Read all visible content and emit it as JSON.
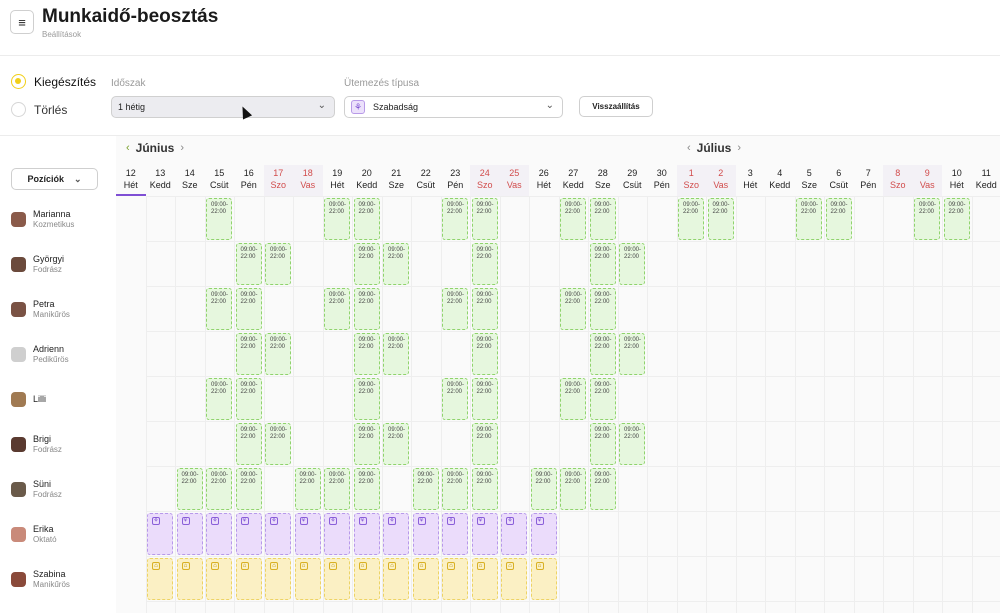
{
  "header": {
    "title": "Munkaidő-beosztás",
    "subtitle": "Beállítások",
    "menu_icon": "hamburger-icon"
  },
  "mode": {
    "options": [
      {
        "label": "Kiegészítés",
        "selected": true
      },
      {
        "label": "Törlés",
        "selected": false
      }
    ]
  },
  "period": {
    "label": "Időszak",
    "value": "1 hétig"
  },
  "schedule_type": {
    "label": "Ütemezés típusa",
    "value": "Szabadság",
    "icon": "vacation-icon"
  },
  "reset_label": "Visszaállítás",
  "positions_label": "Pozíciók",
  "months": [
    {
      "name": "Június"
    },
    {
      "name": "Július"
    }
  ],
  "days": [
    {
      "n": "12",
      "d": "Hét"
    },
    {
      "n": "13",
      "d": "Kedd"
    },
    {
      "n": "14",
      "d": "Sze"
    },
    {
      "n": "15",
      "d": "Csüt"
    },
    {
      "n": "16",
      "d": "Pén"
    },
    {
      "n": "17",
      "d": "Szo"
    },
    {
      "n": "18",
      "d": "Vas"
    },
    {
      "n": "19",
      "d": "Hét"
    },
    {
      "n": "20",
      "d": "Kedd"
    },
    {
      "n": "21",
      "d": "Sze"
    },
    {
      "n": "22",
      "d": "Csüt"
    },
    {
      "n": "23",
      "d": "Pén"
    },
    {
      "n": "24",
      "d": "Szo"
    },
    {
      "n": "25",
      "d": "Vas"
    },
    {
      "n": "26",
      "d": "Hét"
    },
    {
      "n": "27",
      "d": "Kedd"
    },
    {
      "n": "28",
      "d": "Sze"
    },
    {
      "n": "29",
      "d": "Csüt"
    },
    {
      "n": "30",
      "d": "Pén"
    },
    {
      "n": "1",
      "d": "Szo"
    },
    {
      "n": "2",
      "d": "Vas"
    },
    {
      "n": "3",
      "d": "Hét"
    },
    {
      "n": "4",
      "d": "Kedd"
    },
    {
      "n": "5",
      "d": "Sze"
    },
    {
      "n": "6",
      "d": "Csüt"
    },
    {
      "n": "7",
      "d": "Pén"
    },
    {
      "n": "8",
      "d": "Szo"
    },
    {
      "n": "9",
      "d": "Vas"
    },
    {
      "n": "10",
      "d": "Hét"
    },
    {
      "n": "11",
      "d": "Kedd"
    }
  ],
  "shift_text": "09:00-\n22:00",
  "staff": [
    {
      "name": "Marianna",
      "role": "Kozmetikus",
      "avatar": "#8a5a4a",
      "cells": [
        {
          "col": 2,
          "type": "green"
        },
        {
          "col": 6,
          "type": "green"
        },
        {
          "col": 7,
          "type": "green"
        },
        {
          "col": 10,
          "type": "green"
        },
        {
          "col": 11,
          "type": "green"
        },
        {
          "col": 14,
          "type": "green"
        },
        {
          "col": 15,
          "type": "green"
        },
        {
          "col": 18,
          "type": "green"
        },
        {
          "col": 19,
          "type": "green"
        },
        {
          "col": 22,
          "type": "green"
        },
        {
          "col": 23,
          "type": "green"
        },
        {
          "col": 26,
          "type": "green"
        },
        {
          "col": 27,
          "type": "green"
        }
      ]
    },
    {
      "name": "Györgyi",
      "role": "Fodrász",
      "avatar": "#6b4a3c",
      "cells": [
        {
          "col": 3,
          "type": "green"
        },
        {
          "col": 4,
          "type": "green"
        },
        {
          "col": 7,
          "type": "green"
        },
        {
          "col": 8,
          "type": "green"
        },
        {
          "col": 11,
          "type": "green"
        },
        {
          "col": 15,
          "type": "green"
        },
        {
          "col": 16,
          "type": "green"
        }
      ]
    },
    {
      "name": "Petra",
      "role": "Manikűrös",
      "avatar": "#7a5244",
      "cells": [
        {
          "col": 2,
          "type": "green"
        },
        {
          "col": 3,
          "type": "green"
        },
        {
          "col": 6,
          "type": "green"
        },
        {
          "col": 7,
          "type": "green"
        },
        {
          "col": 10,
          "type": "green"
        },
        {
          "col": 11,
          "type": "green"
        },
        {
          "col": 14,
          "type": "green"
        },
        {
          "col": 15,
          "type": "green"
        }
      ]
    },
    {
      "name": "Adrienn",
      "role": "Pedikűrös",
      "avatar": "#cfcfcf",
      "cells": [
        {
          "col": 3,
          "type": "green"
        },
        {
          "col": 4,
          "type": "green"
        },
        {
          "col": 7,
          "type": "green"
        },
        {
          "col": 8,
          "type": "green"
        },
        {
          "col": 11,
          "type": "green"
        },
        {
          "col": 15,
          "type": "green"
        },
        {
          "col": 16,
          "type": "green"
        }
      ]
    },
    {
      "name": "Lilli",
      "role": "",
      "avatar": "#a07a52",
      "cells": [
        {
          "col": 2,
          "type": "green"
        },
        {
          "col": 3,
          "type": "green"
        },
        {
          "col": 7,
          "type": "green"
        },
        {
          "col": 10,
          "type": "green"
        },
        {
          "col": 11,
          "type": "green"
        },
        {
          "col": 14,
          "type": "green"
        },
        {
          "col": 15,
          "type": "green"
        }
      ]
    },
    {
      "name": "Brigi",
      "role": "Fodrász",
      "avatar": "#5a3a30",
      "cells": [
        {
          "col": 3,
          "type": "green"
        },
        {
          "col": 4,
          "type": "green"
        },
        {
          "col": 7,
          "type": "green"
        },
        {
          "col": 8,
          "type": "green"
        },
        {
          "col": 11,
          "type": "green"
        },
        {
          "col": 15,
          "type": "green"
        },
        {
          "col": 16,
          "type": "green"
        }
      ]
    },
    {
      "name": "Süni",
      "role": "Fodrász",
      "avatar": "#6a5a4a",
      "cells": [
        {
          "col": 1,
          "type": "green"
        },
        {
          "col": 2,
          "type": "green"
        },
        {
          "col": 3,
          "type": "green"
        },
        {
          "col": 5,
          "type": "green"
        },
        {
          "col": 6,
          "type": "green"
        },
        {
          "col": 7,
          "type": "green"
        },
        {
          "col": 9,
          "type": "green"
        },
        {
          "col": 10,
          "type": "green"
        },
        {
          "col": 11,
          "type": "green"
        },
        {
          "col": 13,
          "type": "green"
        },
        {
          "col": 14,
          "type": "green"
        },
        {
          "col": 15,
          "type": "green"
        }
      ]
    },
    {
      "name": "Erika",
      "role": "Oktató",
      "avatar": "#c98a7a",
      "cells": [
        {
          "col": 0,
          "type": "purple"
        },
        {
          "col": 1,
          "type": "purple"
        },
        {
          "col": 2,
          "type": "purple"
        },
        {
          "col": 3,
          "type": "purple"
        },
        {
          "col": 4,
          "type": "purple"
        },
        {
          "col": 5,
          "type": "purple"
        },
        {
          "col": 6,
          "type": "purple"
        },
        {
          "col": 7,
          "type": "purple"
        },
        {
          "col": 8,
          "type": "purple"
        },
        {
          "col": 9,
          "type": "purple"
        },
        {
          "col": 10,
          "type": "purple"
        },
        {
          "col": 11,
          "type": "purple"
        },
        {
          "col": 12,
          "type": "purple"
        },
        {
          "col": 13,
          "type": "purple"
        }
      ]
    },
    {
      "name": "Szabina",
      "role": "Manikűrös",
      "avatar": "#8a4a3a",
      "cells": [
        {
          "col": 0,
          "type": "yellow"
        },
        {
          "col": 1,
          "type": "yellow"
        },
        {
          "col": 2,
          "type": "yellow"
        },
        {
          "col": 3,
          "type": "yellow"
        },
        {
          "col": 4,
          "type": "yellow"
        },
        {
          "col": 5,
          "type": "yellow"
        },
        {
          "col": 6,
          "type": "yellow"
        },
        {
          "col": 7,
          "type": "yellow"
        },
        {
          "col": 8,
          "type": "yellow"
        },
        {
          "col": 9,
          "type": "yellow"
        },
        {
          "col": 10,
          "type": "yellow"
        },
        {
          "col": 11,
          "type": "yellow"
        },
        {
          "col": 12,
          "type": "yellow"
        },
        {
          "col": 13,
          "type": "yellow"
        }
      ]
    }
  ]
}
